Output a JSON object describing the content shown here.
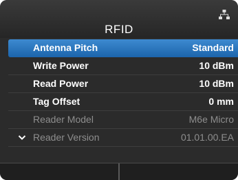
{
  "header": {
    "title": "RFID",
    "status_icon": "network-icon"
  },
  "menu": {
    "items": [
      {
        "label": "Antenna Pitch",
        "value": "Standard",
        "state": "selected"
      },
      {
        "label": "Write Power",
        "value": "10 dBm",
        "state": "normal"
      },
      {
        "label": "Read Power",
        "value": "10 dBm",
        "state": "normal"
      },
      {
        "label": "Tag Offset",
        "value": "0 mm",
        "state": "normal"
      },
      {
        "label": "Reader Model",
        "value": "M6e Micro",
        "state": "disabled"
      },
      {
        "label": "Reader Version",
        "value": "01.01.00.EA",
        "state": "disabled",
        "icon": "chevron-down-icon"
      }
    ]
  },
  "colors": {
    "background": "#2b2b2b",
    "selected_row": "#2a78c0",
    "disabled_text": "#8e8e8e"
  }
}
